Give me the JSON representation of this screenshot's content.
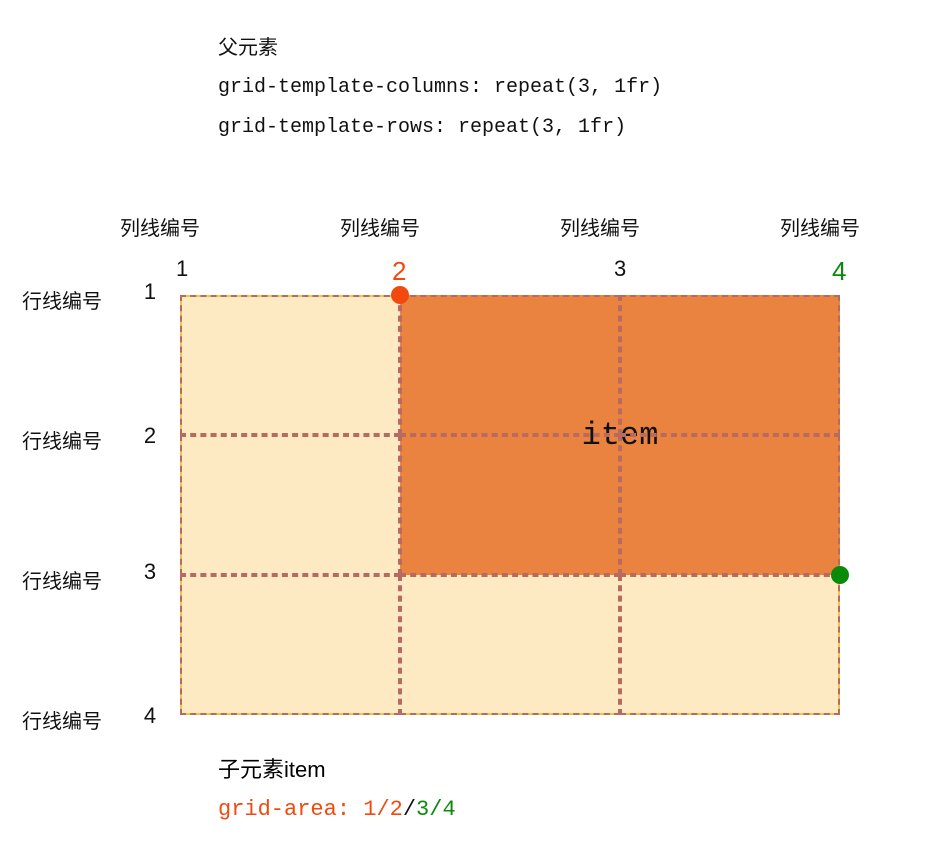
{
  "header": {
    "parent_label": "父元素",
    "code_cols": "grid-template-columns: repeat(3, 1fr)",
    "code_rows": "grid-template-rows: repeat(3, 1fr)"
  },
  "col_label_text": "列线编号",
  "row_label_text": "行线编号",
  "columns": [
    "1",
    "2",
    "3",
    "4"
  ],
  "rows": [
    "1",
    "2",
    "3",
    "4"
  ],
  "item_label": "item",
  "footer": {
    "child_label": "子元素item",
    "prop_name": "grid-area: ",
    "v1": "1",
    "v2": "2",
    "v3": "3",
    "v4": "4",
    "slash": "/"
  },
  "colors": {
    "orange": "#f24a0e",
    "green": "#0a8a0a",
    "item_bg": "#e9833f",
    "grid_bg": "#fde9c2",
    "dash": "#b76a5f"
  }
}
